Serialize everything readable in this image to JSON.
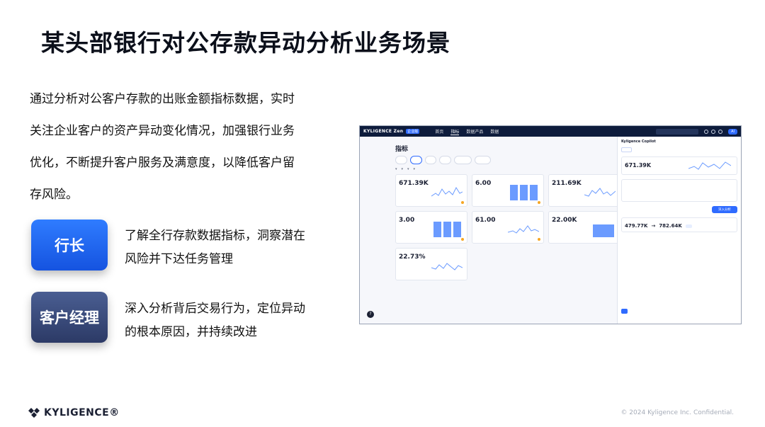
{
  "slide": {
    "title": "某头部银行对公存款异动分析业务场景",
    "intro": "通过分析对公客户存款的出账金额指标数据，实时关注企业客户的资产异动变化情况，加强银行业务优化，不断提升客户服务及满意度，以降低客户留存风险。",
    "roles": [
      {
        "label": "行长",
        "desc": "了解全行存款数据指标，洞察潜在风险并下达任务管理"
      },
      {
        "label": "客户经理",
        "desc": "深入分析背后交易行为，定位异动的根本原因，并持续改进"
      }
    ],
    "footer_logo": "KYLIGENCE®",
    "footer_copy": "© 2024 Kyligence Inc. Confidential."
  },
  "app": {
    "brand": "KYLIGENCE Zen",
    "brand_tag": "企业版",
    "nav": [
      "首页",
      "指标",
      "数据产品",
      "数据"
    ],
    "page_title": "指标",
    "cards": [
      {
        "value": "671.39K",
        "viz": "spark"
      },
      {
        "value": "6.00",
        "viz": "bars"
      },
      {
        "value": "211.69K",
        "viz": "spark"
      },
      {
        "value": "3.00",
        "viz": "bars"
      },
      {
        "value": "61.00",
        "viz": "spark"
      },
      {
        "value": "22.00K",
        "viz": "bar"
      },
      {
        "value": "22.73%",
        "viz": "spark"
      }
    ],
    "copilot": {
      "title": "Kyligence Copilot",
      "card_value": "671.39K",
      "user_msg": "深入分析",
      "from_value": "479.77K",
      "to_value": "782.64K",
      "arrow": "→"
    }
  },
  "colors": {
    "primary": "#2f6bff",
    "role1": "#1f66f2",
    "role2": "#34447a",
    "topbar": "#0e1c3c"
  }
}
